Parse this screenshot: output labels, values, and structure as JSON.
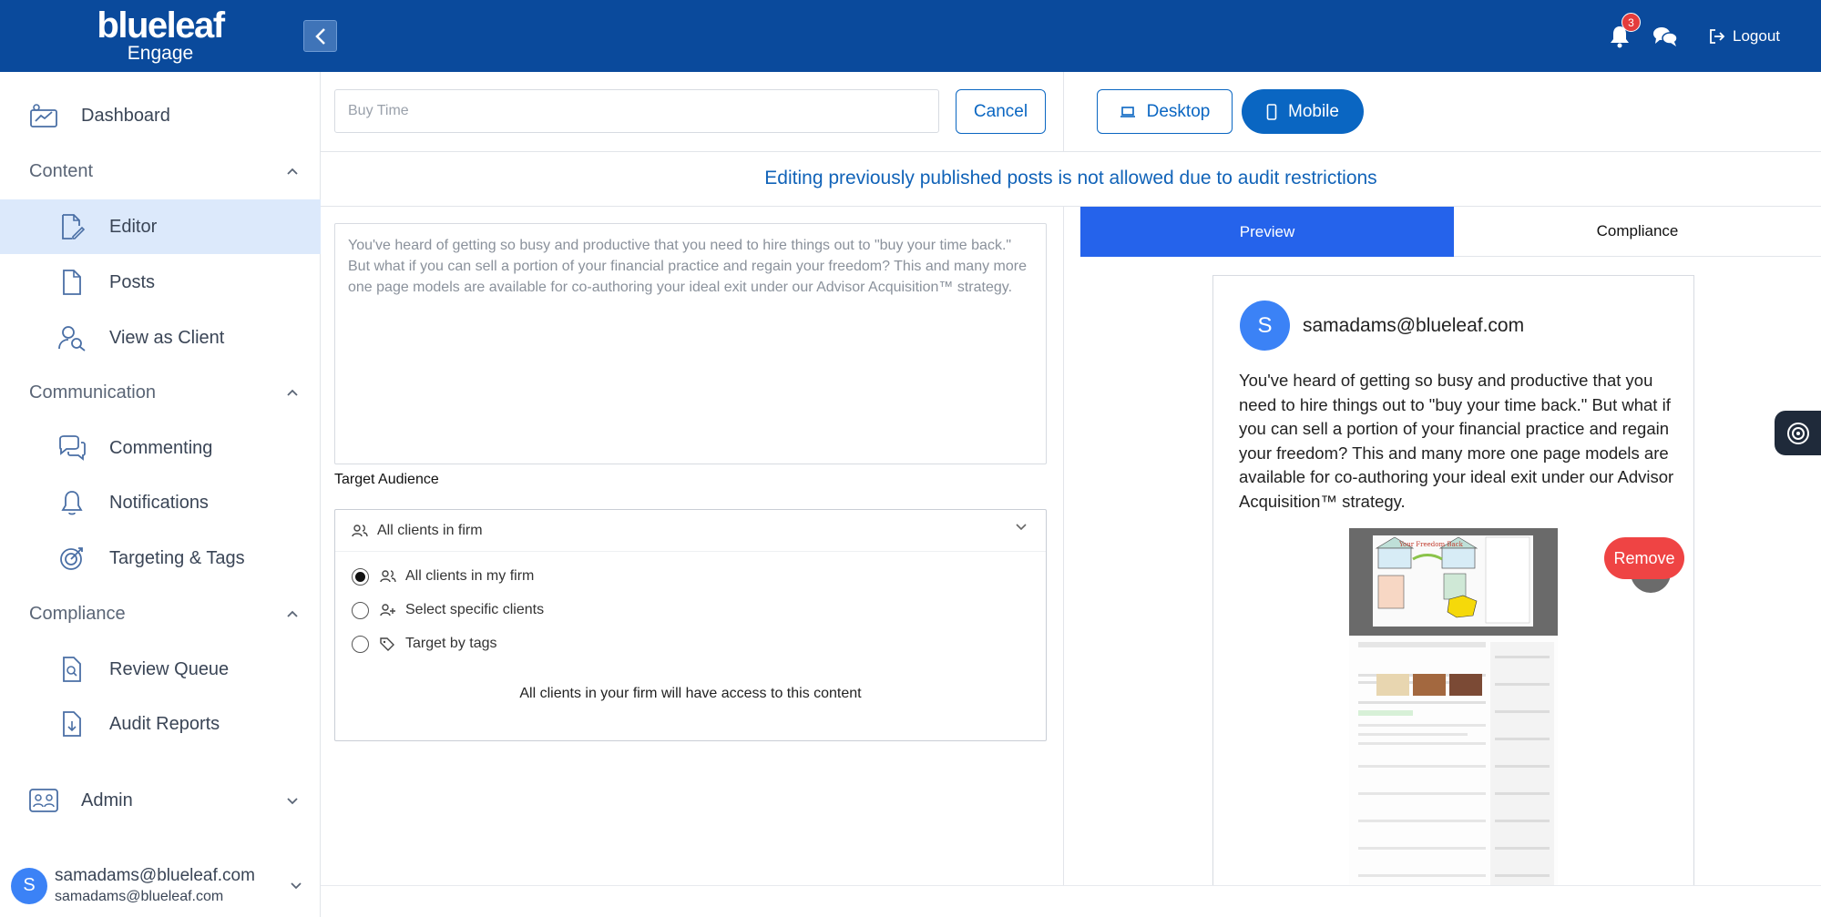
{
  "header": {
    "logo_brand": "blueleaf",
    "logo_sub": "Engage",
    "notification_count": "3",
    "logout_label": "Logout"
  },
  "sidebar": {
    "dashboard": "Dashboard",
    "content_section": "Content",
    "editor": "Editor",
    "posts": "Posts",
    "view_as_client": "View as Client",
    "communication_section": "Communication",
    "commenting": "Commenting",
    "notifications": "Notifications",
    "targeting_tags": "Targeting & Tags",
    "compliance_section": "Compliance",
    "review_queue": "Review Queue",
    "audit_reports": "Audit Reports",
    "admin": "Admin",
    "user_initial": "S",
    "user_name": "samadams@blueleaf.com",
    "user_email": "samadams@blueleaf.com"
  },
  "editor": {
    "title_placeholder": "Buy Time",
    "cancel_label": "Cancel",
    "desktop_label": "Desktop",
    "mobile_label": "Mobile",
    "notice": "Editing previously published posts is not allowed due to audit restrictions",
    "body_text": "You've heard of getting so busy and productive that you need to hire things out to \"buy your time back.\" But what if you can sell a portion of your financial practice and regain your freedom? This and many more one page models are available for co-authoring your ideal exit under our Advisor Acquisition™ strategy.",
    "target_audience_label": "Target Audience",
    "audience_selected": "All clients in firm",
    "options": [
      {
        "label": "All clients in my firm",
        "checked": true
      },
      {
        "label": "Select specific clients",
        "checked": false
      },
      {
        "label": "Target by tags",
        "checked": false
      }
    ],
    "audience_note": "All clients in your firm will have access to this content"
  },
  "preview": {
    "tab_preview": "Preview",
    "tab_compliance": "Compliance",
    "author_initial": "S",
    "author_email": "samadams@blueleaf.com",
    "body_text": "You've heard of getting so busy and productive that you need to hire things out to \"buy your time back.\" But what if you can sell a portion of your financial practice and regain your freedom? This and many more one page models are available for co-authoring your ideal exit under our Advisor Acquisition™ strategy.",
    "remove_label": "Remove"
  },
  "colors": {
    "header_bg": "#0a4a9c",
    "accent": "#0a66c2",
    "tab_active": "#2563eb",
    "remove": "#ef4444",
    "active_nav": "#dce9fb"
  }
}
